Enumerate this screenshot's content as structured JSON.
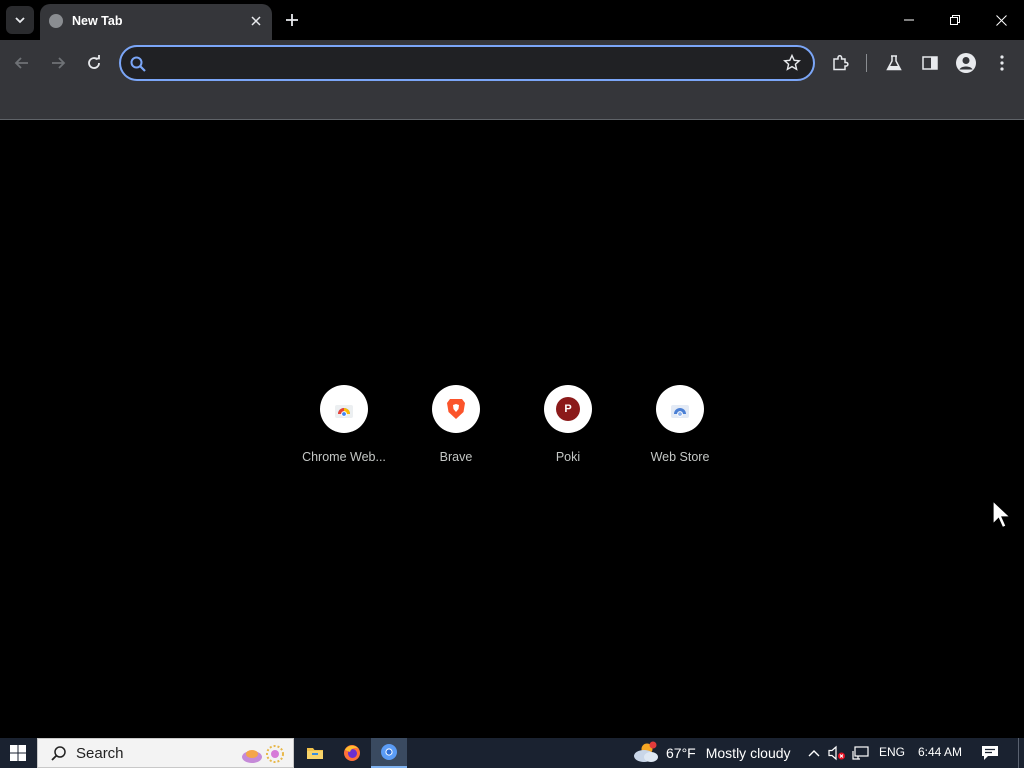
{
  "browser": {
    "tab": {
      "title": "New Tab",
      "close_label": "×"
    },
    "new_tab_label": "+",
    "omnibox": {
      "value": "",
      "placeholder": ""
    }
  },
  "shortcuts": [
    {
      "label": "Chrome Web...",
      "icon": "chrome-web-store-icon"
    },
    {
      "label": "Brave",
      "icon": "brave-icon"
    },
    {
      "label": "Poki",
      "icon": "poki-icon",
      "letter": "P"
    },
    {
      "label": "Web Store",
      "icon": "web-store-icon"
    }
  ],
  "taskbar": {
    "search_label": "Search",
    "weather": {
      "temp": "67°F",
      "condition": "Mostly cloudy"
    },
    "language": "ENG",
    "time": "6:44 AM"
  },
  "colors": {
    "accent": "#7ba6f7",
    "toolbar": "#35363a",
    "poki": "#8b1a1a"
  }
}
